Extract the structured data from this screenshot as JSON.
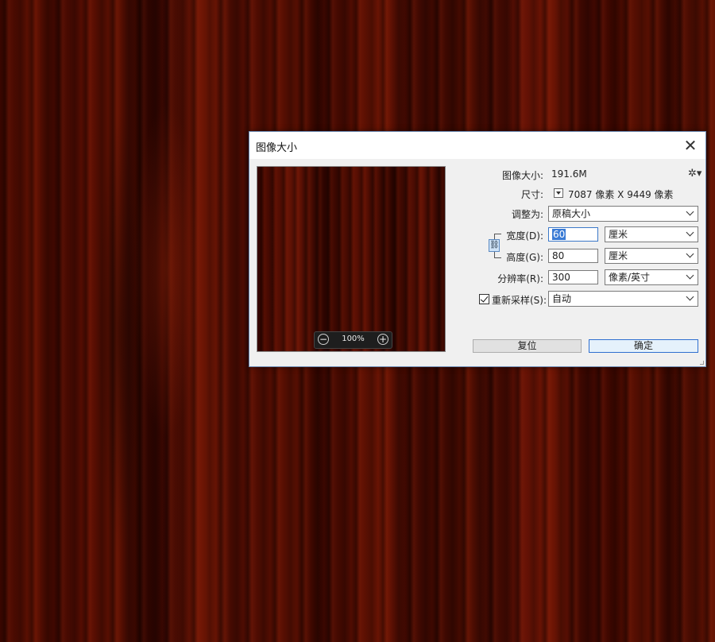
{
  "dialog": {
    "title": "图像大小",
    "close_glyph": "✕",
    "image_size_label": "图像大小:",
    "image_size_value": "191.6M",
    "gear_glyph": "✲▾",
    "dimensions_label": "尺寸:",
    "dimensions_value": "7087 像素  X  9449 像素",
    "fit_to_label": "调整为:",
    "fit_to_value": "原稿大小",
    "width_label": "宽度(D):",
    "width_value": "60",
    "width_unit": "厘米",
    "height_label": "高度(G):",
    "height_value": "80",
    "height_unit": "厘米",
    "resolution_label": "分辨率(R):",
    "resolution_value": "300",
    "resolution_unit": "像素/英寸",
    "resample_label": "重新采样(S):",
    "resample_checked": true,
    "resample_value": "自动",
    "reset_label": "复位",
    "ok_label": "确定",
    "preview": {
      "zoom_value": "100%",
      "zoom_out_glyph": "−",
      "zoom_in_glyph": "+"
    }
  }
}
